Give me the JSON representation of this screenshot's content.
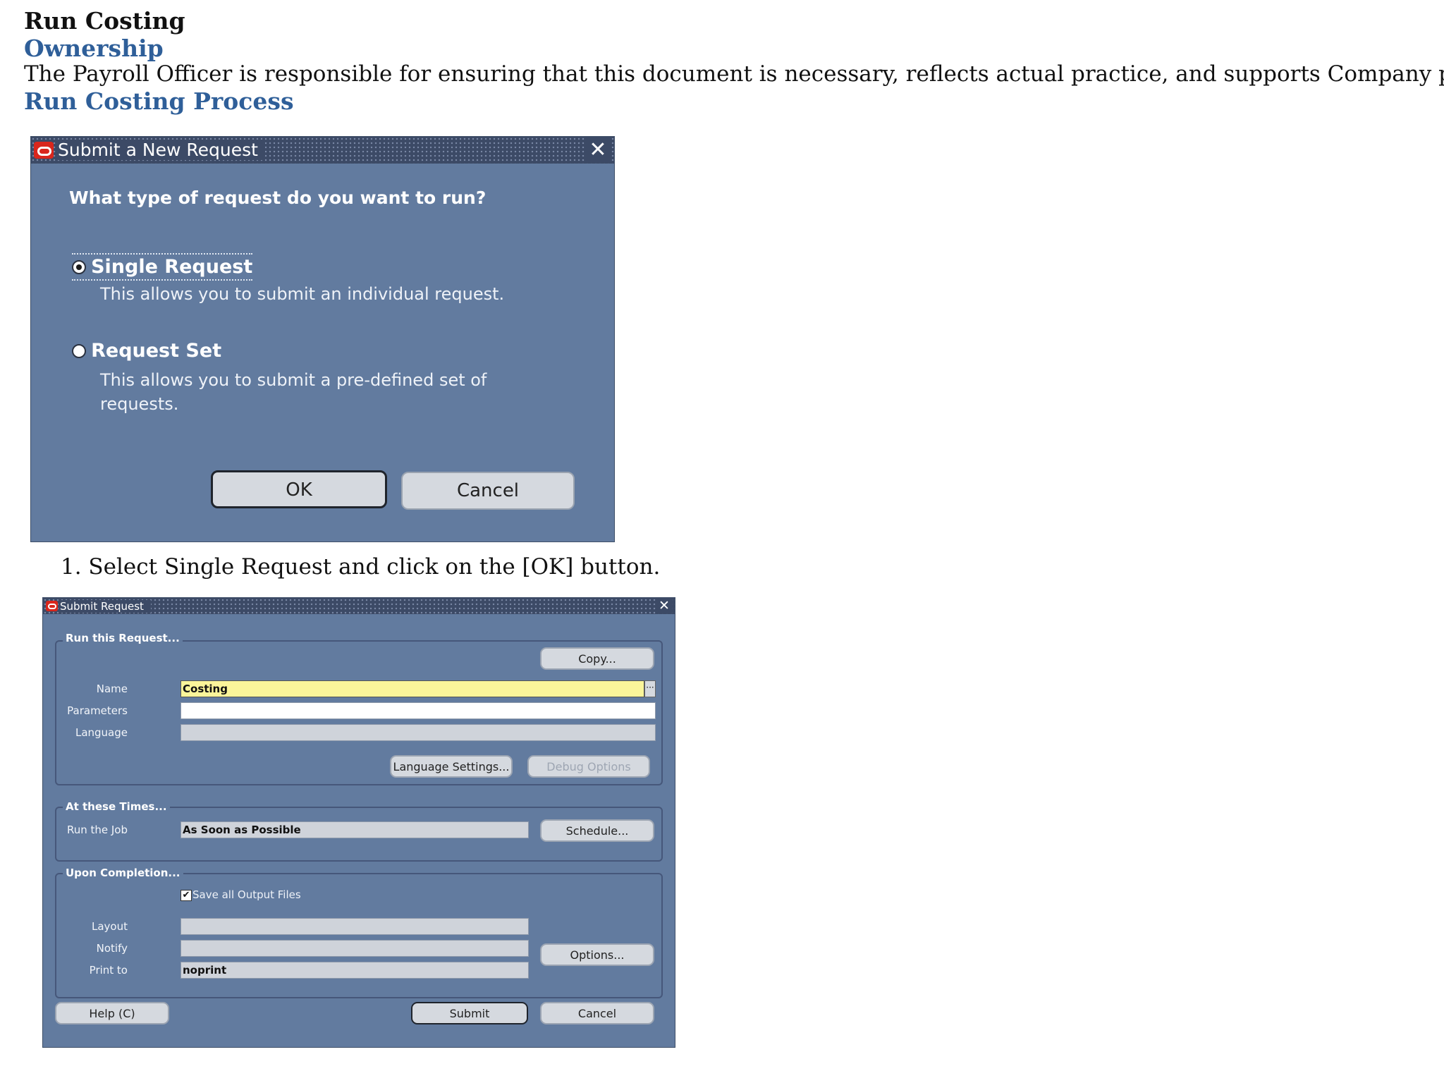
{
  "doc": {
    "title": "Run Costing",
    "ownership_heading": "Ownership",
    "ownership_text": "The Payroll Officer is responsible for ensuring that this document is necessary, reflects actual practice, and supports Company  policy.",
    "process_heading": "Run Costing Process",
    "step1": "1. Select Single Request and click on the [OK] button."
  },
  "dialog1": {
    "title": "Submit a New Request",
    "question": "What type of request do you want to run?",
    "options": [
      {
        "label": "Single Request",
        "description": "This allows you to submit an individual request.",
        "selected": true
      },
      {
        "label": "Request Set",
        "description": "This allows you to submit a pre-defined set of requests.",
        "selected": false
      }
    ],
    "ok_label": "OK",
    "cancel_label": "Cancel",
    "close_icon": "close-icon"
  },
  "dialog2": {
    "title": "Submit Request",
    "run_group": {
      "label": "Run this Request...",
      "copy_label": "Copy...",
      "name_label": "Name",
      "name_value": "Costing",
      "parameters_label": "Parameters",
      "parameters_value": "",
      "language_label": "Language",
      "language_value": "",
      "language_settings_label": "Language Settings...",
      "debug_options_label": "Debug Options"
    },
    "times_group": {
      "label": "At these Times...",
      "run_job_label": "Run the Job",
      "run_job_value": "As Soon as Possible",
      "schedule_label": "Schedule..."
    },
    "upon_group": {
      "label": "Upon Completion...",
      "save_output_label": "Save all Output Files",
      "save_output_checked": "✔",
      "layout_label": "Layout",
      "layout_value": "",
      "notify_label": "Notify",
      "notify_value": "",
      "print_to_label": "Print to",
      "print_to_value": "noprint",
      "options_label": "Options..."
    },
    "help_label": "Help (C)",
    "submit_label": "Submit",
    "cancel_label": "Cancel"
  },
  "colors": {
    "dialog_bg": "#627b9f",
    "titlebar_bg": "#3c4a66",
    "heading_blue": "#2f5f99",
    "name_field_bg": "#fbf59a"
  }
}
